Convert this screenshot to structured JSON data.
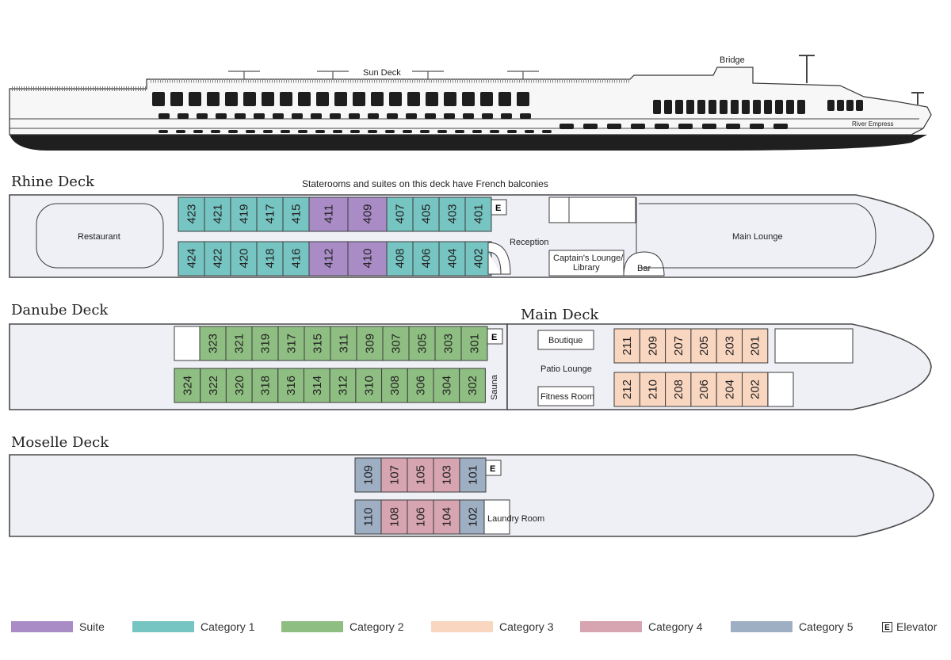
{
  "colors": {
    "suite": "#a98cc6",
    "category1": "#76c5c2",
    "category2": "#8fbe82",
    "category3": "#f9d6c0",
    "category4": "#d7a4b1",
    "category5": "#9eafc3",
    "hull": "#eef0f6"
  },
  "profile": {
    "sun_deck_label": "Sun Deck",
    "bridge_label": "Bridge",
    "ship_name": "River Empress"
  },
  "decks": {
    "rhine": {
      "title": "Rhine Deck",
      "note": "Staterooms and suites on this deck have French balconies",
      "top_cabins": [
        {
          "n": "423",
          "cat": "category1"
        },
        {
          "n": "421",
          "cat": "category1"
        },
        {
          "n": "419",
          "cat": "category1"
        },
        {
          "n": "417",
          "cat": "category1"
        },
        {
          "n": "415",
          "cat": "category1"
        },
        {
          "n": "411",
          "cat": "suite"
        },
        {
          "n": "409",
          "cat": "suite"
        },
        {
          "n": "407",
          "cat": "category1"
        },
        {
          "n": "405",
          "cat": "category1"
        },
        {
          "n": "403",
          "cat": "category1"
        },
        {
          "n": "401",
          "cat": "category1"
        }
      ],
      "bottom_cabins": [
        {
          "n": "424",
          "cat": "category1"
        },
        {
          "n": "422",
          "cat": "category1"
        },
        {
          "n": "420",
          "cat": "category1"
        },
        {
          "n": "418",
          "cat": "category1"
        },
        {
          "n": "416",
          "cat": "category1"
        },
        {
          "n": "412",
          "cat": "suite"
        },
        {
          "n": "410",
          "cat": "suite"
        },
        {
          "n": "408",
          "cat": "category1"
        },
        {
          "n": "406",
          "cat": "category1"
        },
        {
          "n": "404",
          "cat": "category1"
        },
        {
          "n": "402",
          "cat": "category1"
        }
      ],
      "restaurant": "Restaurant",
      "reception": "Reception",
      "captains_lounge_1": "Captain's Lounge/",
      "captains_lounge_2": "Library",
      "bar": "Bar",
      "main_lounge": "Main Lounge",
      "elevator": "E"
    },
    "danube": {
      "title": "Danube Deck",
      "top_cabins": [
        "323",
        "321",
        "319",
        "317",
        "315",
        "311",
        "309",
        "307",
        "305",
        "303",
        "301"
      ],
      "bottom_cabins": [
        "324",
        "322",
        "320",
        "318",
        "316",
        "314",
        "312",
        "310",
        "308",
        "306",
        "304",
        "302"
      ],
      "sauna": "Sauna",
      "elevator": "E"
    },
    "main": {
      "title": "Main Deck",
      "boutique": "Boutique",
      "patio_lounge": "Patio Lounge",
      "fitness_room": "Fitness Room",
      "top_cabins": [
        "211",
        "209",
        "207",
        "205",
        "203",
        "201"
      ],
      "bottom_cabins": [
        "212",
        "210",
        "208",
        "206",
        "204",
        "202"
      ]
    },
    "moselle": {
      "title": "Moselle Deck",
      "top_cabins": [
        {
          "n": "109",
          "cat": "category5"
        },
        {
          "n": "107",
          "cat": "category4"
        },
        {
          "n": "105",
          "cat": "category4"
        },
        {
          "n": "103",
          "cat": "category4"
        },
        {
          "n": "101",
          "cat": "category5"
        }
      ],
      "bottom_cabins": [
        {
          "n": "110",
          "cat": "category5"
        },
        {
          "n": "108",
          "cat": "category4"
        },
        {
          "n": "106",
          "cat": "category4"
        },
        {
          "n": "104",
          "cat": "category4"
        },
        {
          "n": "102",
          "cat": "category5"
        }
      ],
      "laundry_room": "Laundry Room",
      "elevator": "E"
    }
  },
  "legend": [
    {
      "label": "Suite",
      "color": "#a98cc6"
    },
    {
      "label": "Category 1",
      "color": "#76c5c2"
    },
    {
      "label": "Category 2",
      "color": "#8fbe82"
    },
    {
      "label": "Category 3",
      "color": "#f9d6c0"
    },
    {
      "label": "Category 4",
      "color": "#d7a4b1"
    },
    {
      "label": "Category 5",
      "color": "#9eafc3"
    }
  ],
  "legend_elevator": {
    "symbol": "E",
    "label": "Elevator"
  }
}
